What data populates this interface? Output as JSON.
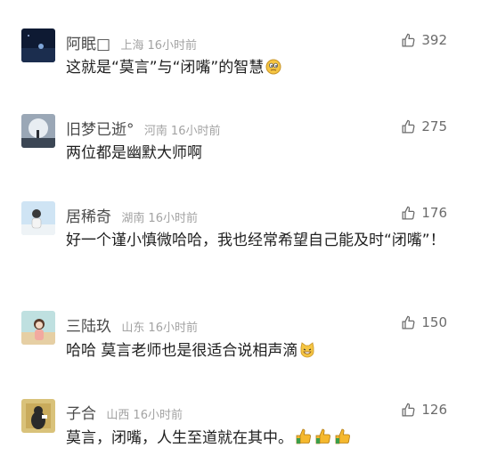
{
  "comments": [
    {
      "user": "阿眠□",
      "location": "上海",
      "time": "16小时前",
      "likes": "392",
      "text": "这就是“莫言”与“闭嘴”的智慧",
      "emoji": "thinking-face-emoji"
    },
    {
      "user": "旧梦已逝°",
      "location": "河南",
      "time": "16小时前",
      "likes": "275",
      "text": "两位都是幽默大师啊"
    },
    {
      "user": "居稀奇",
      "location": "湖南",
      "time": "16小时前",
      "likes": "176",
      "text": "好一个谨小慎微哈哈，我也经常希望自己能及时“闭嘴”！"
    },
    {
      "user": "三陆玖",
      "location": "山东",
      "time": "16小时前",
      "likes": "150",
      "text": "哈哈 莫言老师也是很适合说相声滴",
      "emoji": "grinning-cat-emoji"
    },
    {
      "user": "子合",
      "location": "山西",
      "time": "16小时前",
      "likes": "126",
      "text": "莫言，闭嘴，人生至道就在其中。",
      "emoji": "thumbs-up-emoji x3"
    }
  ]
}
